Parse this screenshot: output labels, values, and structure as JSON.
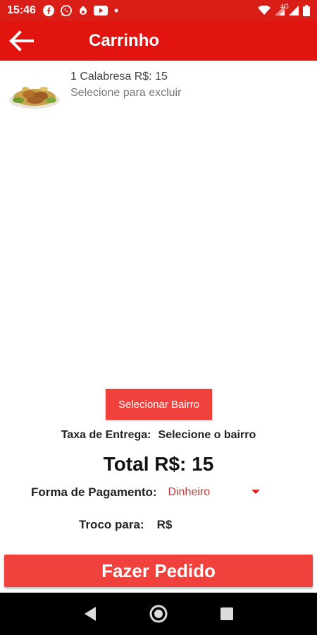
{
  "status_bar": {
    "time": "15:46",
    "left_icons": [
      "facebook-icon",
      "whatsapp-icon",
      "pin-icon",
      "youtube-icon",
      "dot-icon"
    ],
    "right_icons": [
      "wifi-icon",
      "signal-icon",
      "signal-4g-icon",
      "battery-icon"
    ],
    "network_label": "4G"
  },
  "app_bar": {
    "title": "Carrinho",
    "back_icon": "arrow-left-icon"
  },
  "cart": {
    "items": [
      {
        "line1": "1 Calabresa R$: 15",
        "line2": "Selecione para excluir",
        "image": "pizza-icon"
      }
    ]
  },
  "bairro_button": {
    "label": "Selecionar Bairro"
  },
  "taxa": {
    "label": "Taxa de Entrega:",
    "value": "Selecione o bairro"
  },
  "total": {
    "label": "Total R$:",
    "value": "15"
  },
  "pagamento": {
    "label": "Forma de Pagamento:",
    "selected": "Dinheiro"
  },
  "troco": {
    "label": "Troco para:",
    "value": "R$"
  },
  "pedido_button": {
    "label": "Fazer Pedido"
  },
  "colors": {
    "primary": "#e1140f",
    "button": "#f0413c",
    "status_bar": "#d91e18",
    "nav_bar": "#000000"
  }
}
